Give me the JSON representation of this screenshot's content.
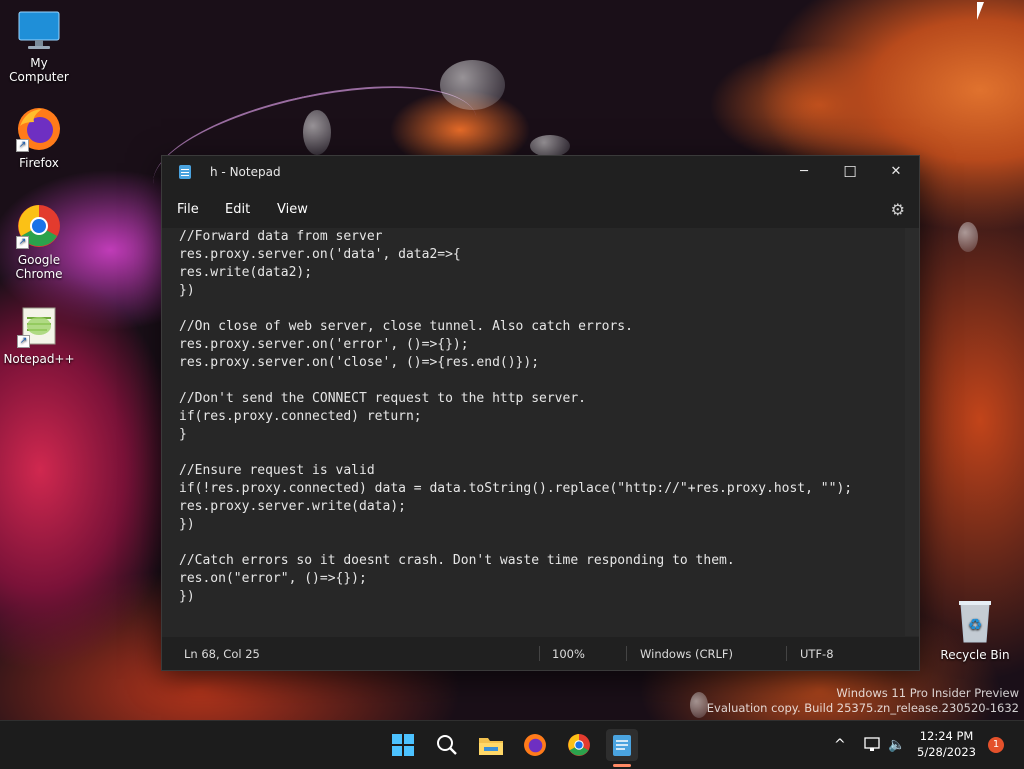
{
  "desktop": {
    "icons": [
      {
        "label": "My Computer",
        "icon": "monitor-icon"
      },
      {
        "label": "Firefox",
        "icon": "firefox-icon"
      },
      {
        "label": "Google Chrome",
        "icon": "chrome-icon"
      },
      {
        "label": "Notepad++",
        "icon": "notepadpp-icon"
      },
      {
        "label": "Recycle Bin",
        "icon": "recycle-bin-icon"
      }
    ],
    "watermark": {
      "line1": "Windows 11 Pro Insider Preview",
      "line2": "Evaluation copy. Build 25375.zn_release.230520-1632"
    }
  },
  "notepad": {
    "title": "h - Notepad",
    "controls": {
      "minimize": "─",
      "maximize": "☐",
      "close": "✕"
    },
    "menu": [
      "File",
      "Edit",
      "View"
    ],
    "settings_icon": "gear-icon",
    "editor_lines": [
      "//Forward data from server",
      "res.proxy.server.on('data', data2=>{",
      "res.write(data2);",
      "})",
      "",
      "//On close of web server, close tunnel. Also catch errors.",
      "res.proxy.server.on('error', ()=>{});",
      "res.proxy.server.on('close', ()=>{res.end()});",
      "",
      "//Don't send the CONNECT request to the http server.",
      "if(res.proxy.connected) return;",
      "}",
      "",
      "//Ensure request is valid",
      "if(!res.proxy.connected) data = data.toString().replace(\"http://\"+res.proxy.host, \"\");",
      "res.proxy.server.write(data);",
      "})",
      "",
      "//Catch errors so it doesnt crash. Don't waste time responding to them.",
      "res.on(\"error\", ()=>{});",
      "})"
    ],
    "status": {
      "position": "Ln 68, Col 25",
      "zoom": "100%",
      "line_ending": "Windows (CRLF)",
      "encoding": "UTF-8"
    }
  },
  "taskbar": {
    "items": [
      "windows-start-icon",
      "search-icon",
      "file-explorer-icon",
      "firefox-icon",
      "chrome-icon",
      "notepad-icon"
    ],
    "tray": {
      "chevron": "^",
      "time": "12:24 PM",
      "date": "5/28/2023",
      "notifications": "1"
    }
  }
}
